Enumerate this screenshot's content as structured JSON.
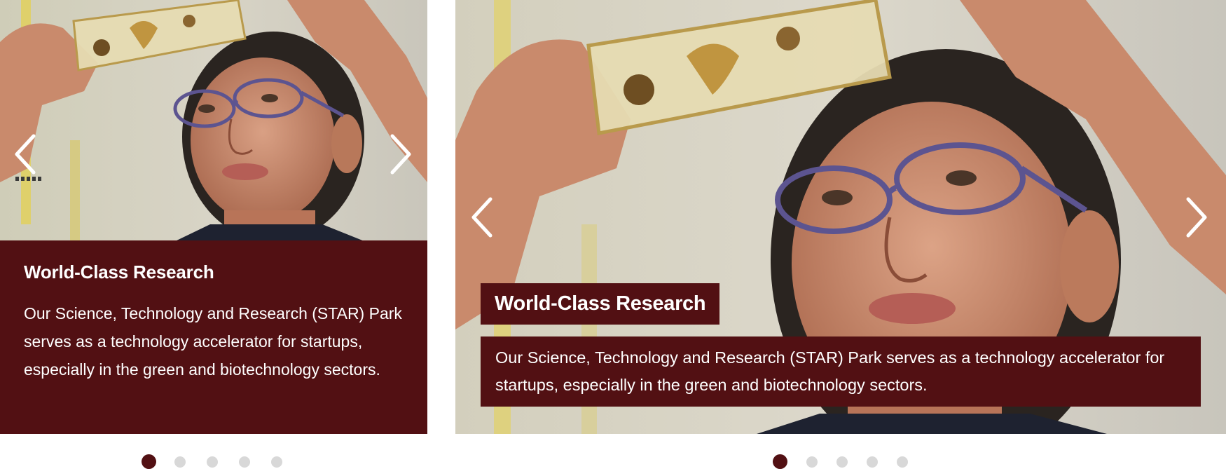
{
  "slides": [
    {
      "title": "World-Class Research",
      "body": "Our Science, Technology and Research (STAR) Park serves as a technology accelerator for startups, especially in the green and biotechnology sectors."
    },
    {
      "title": "World-Class Research",
      "body": "Our Science, Technology and Research (STAR) Park serves as a technology accelerator for startups, especially in the green and biotechnology sectors."
    }
  ],
  "icons": {
    "prev": "chevron-left-icon",
    "next": "chevron-right-icon"
  },
  "pagination": {
    "count": 5,
    "active_index": 0
  },
  "colors": {
    "caption_bg": "#521013",
    "caption_text": "#ffffff",
    "dot_active": "#521013",
    "dot_inactive": "#d8d8d8"
  }
}
